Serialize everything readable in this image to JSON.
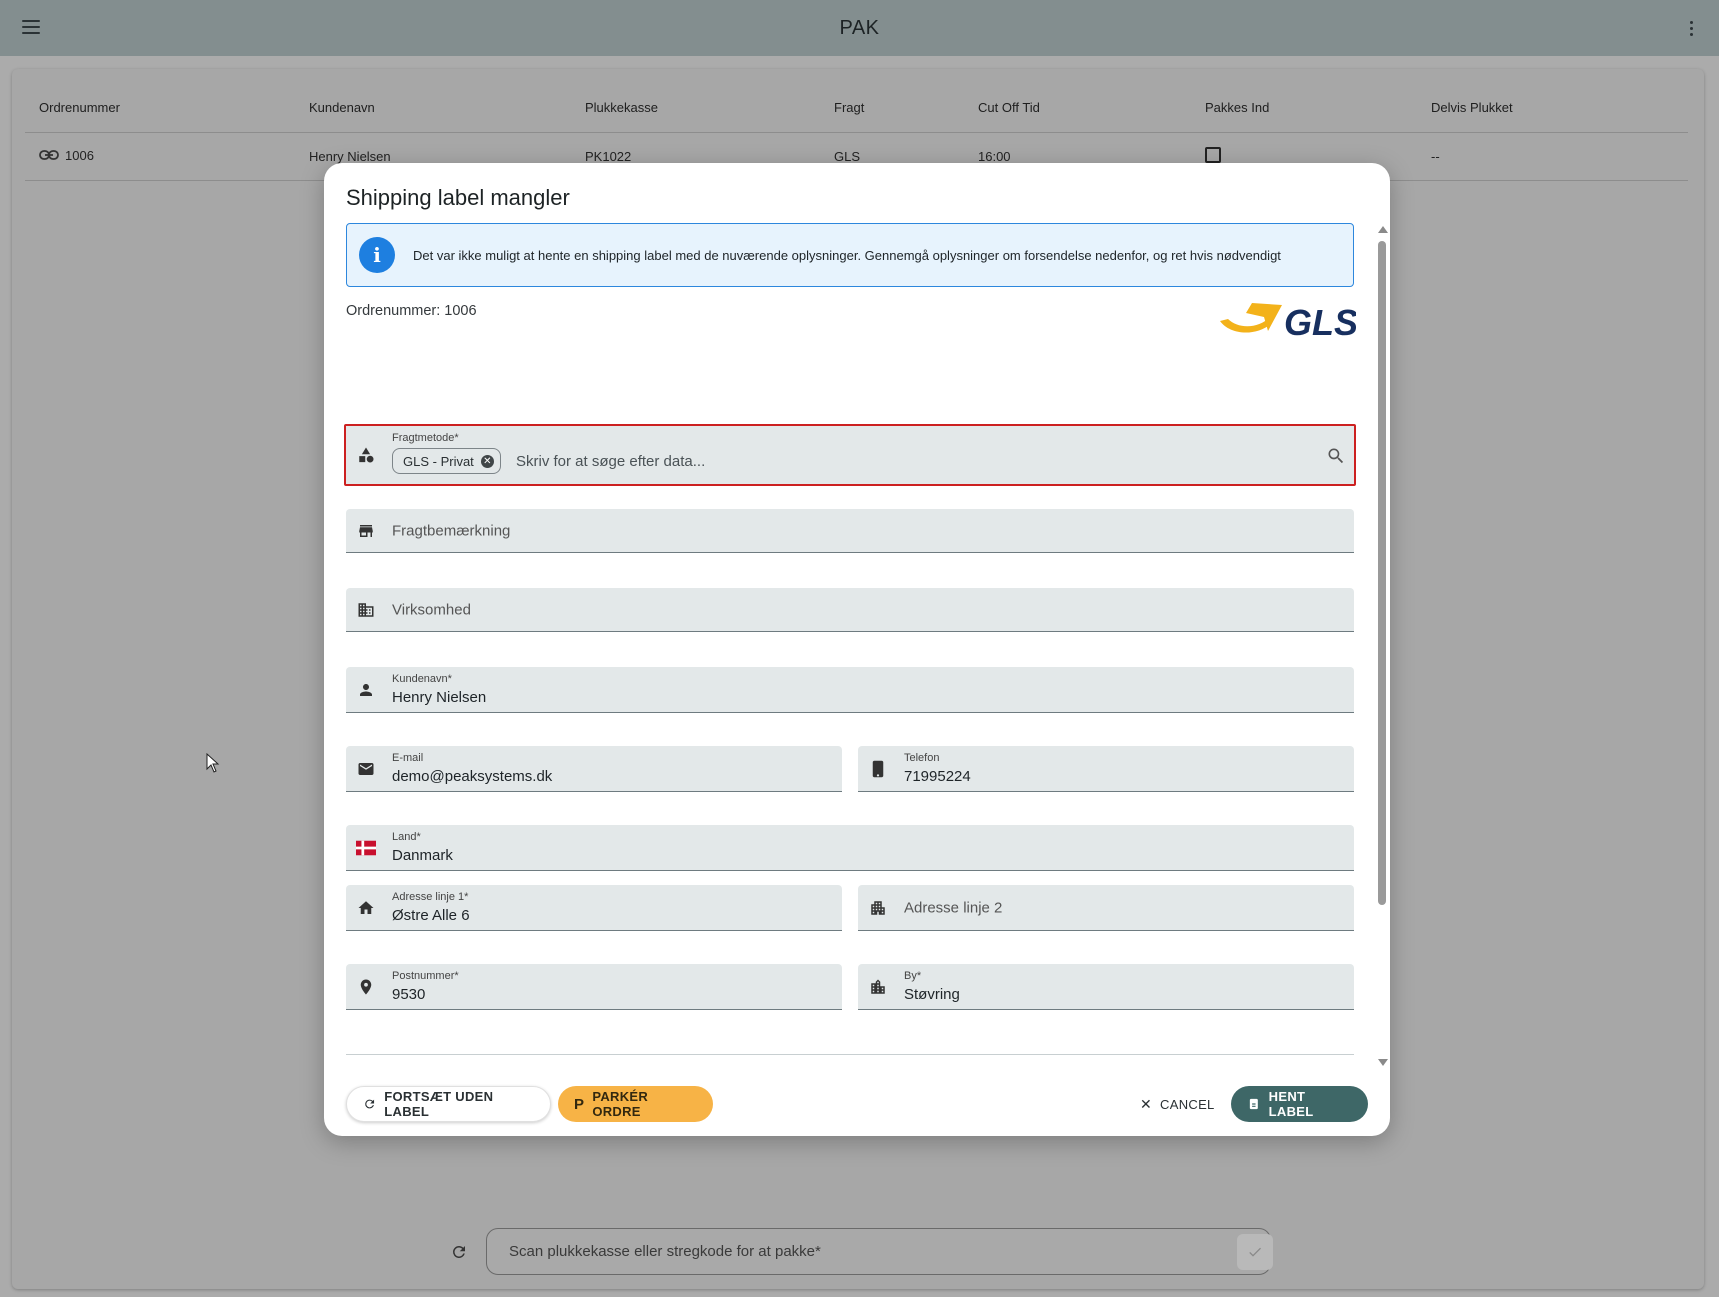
{
  "appbar": {
    "title": "PAK"
  },
  "table": {
    "headers": [
      "Ordrenummer",
      "Kundenavn",
      "Plukkekasse",
      "Fragt",
      "Cut Off Tid",
      "Pakkes Ind",
      "Delvis Plukket"
    ],
    "rows": [
      {
        "order": "1006",
        "customer": "Henry Nielsen",
        "box": "PK1022",
        "freight": "GLS",
        "cutoff": "16:00",
        "packed_in": false,
        "partial": "--"
      }
    ]
  },
  "scan": {
    "placeholder": "Scan plukkekasse eller stregkode for at pakke*"
  },
  "modal": {
    "title": "Shipping label mangler",
    "alert_text": "Det var ikke muligt at hente en shipping label med de nuværende oplysninger. Gennemgå oplysninger om forsendelse nedenfor, og ret hvis nødvendigt",
    "order_number_label": "Ordrenummer: 1006",
    "logo_text": "GLS",
    "fields": {
      "fragtmetode": {
        "label": "Fragtmetode*",
        "chip": "GLS - Privat",
        "placeholder": "Skriv for at søge efter data..."
      },
      "fragtbemaerkning": {
        "placeholder": "Fragtbemærkning"
      },
      "virksomhed": {
        "placeholder": "Virksomhed"
      },
      "kundenavn": {
        "label": "Kundenavn*",
        "value": "Henry Nielsen"
      },
      "email": {
        "label": "E-mail",
        "value": "demo@peaksystems.dk"
      },
      "telefon": {
        "label": "Telefon",
        "value": "71995224"
      },
      "land": {
        "label": "Land*",
        "value": "Danmark"
      },
      "adresse1": {
        "label": "Adresse linje 1*",
        "value": "Østre Alle 6"
      },
      "adresse2": {
        "placeholder": "Adresse linje 2"
      },
      "postnummer": {
        "label": "Postnummer*",
        "value": "9530"
      },
      "by": {
        "label": "By*",
        "value": "Støvring"
      }
    },
    "buttons": {
      "continue": "FORTSÆT UDEN LABEL",
      "park": "PARKÉR ORDRE",
      "cancel": "CANCEL",
      "fetch": "HENT LABEL"
    }
  },
  "colors": {
    "accent": "#3e6767",
    "warning": "#f7b346",
    "error": "#cc2020",
    "info": "#1e7fe0"
  }
}
